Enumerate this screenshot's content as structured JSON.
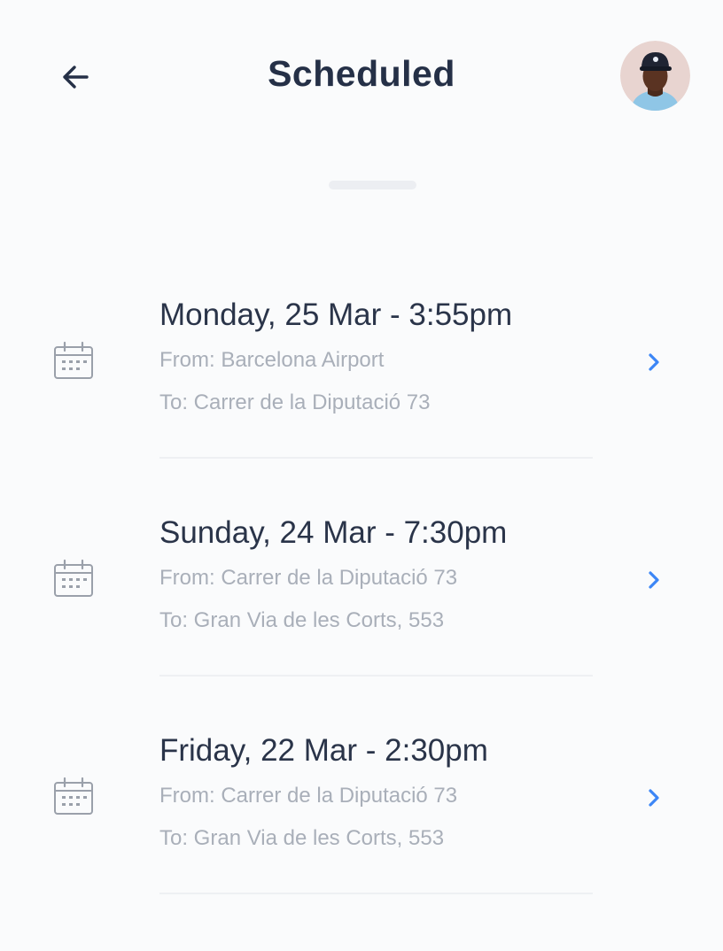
{
  "header": {
    "title": "Scheduled",
    "back_icon": "arrow-left-icon",
    "avatar_icon": "user-avatar"
  },
  "colors": {
    "title": "#253047",
    "secondary_text": "#a9afb9",
    "accent": "#3c86f6",
    "background": "#fafbfc"
  },
  "trips": [
    {
      "date": "Monday, 25 Mar - 3:55pm",
      "from": "From: Barcelona Airport",
      "to": "To: Carrer de la Diputació 73"
    },
    {
      "date": "Sunday, 24 Mar - 7:30pm",
      "from": "From: Carrer de la Diputació 73",
      "to": "To: Gran Via de les Corts, 553"
    },
    {
      "date": "Friday, 22 Mar - 2:30pm",
      "from": "From: Carrer de la Diputació 73",
      "to": "To: Gran Via de les Corts, 553"
    }
  ]
}
